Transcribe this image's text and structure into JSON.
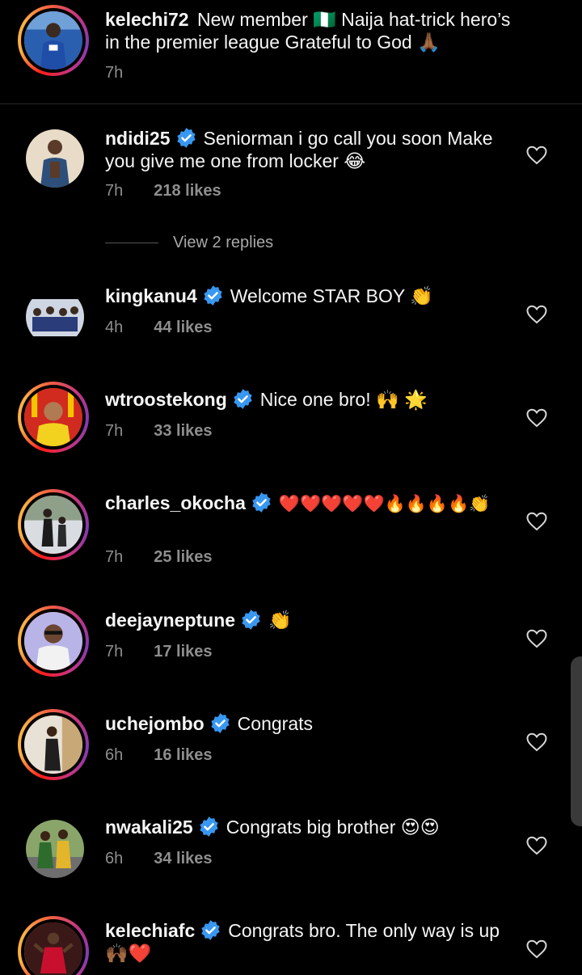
{
  "caption": {
    "username": "kelechi72",
    "text": "New member 🇳🇬 Naija hat-trick hero’s in the premier league Grateful to God 🙏🏾",
    "time": "7h"
  },
  "replies_toggle": {
    "label": "View 2 replies"
  },
  "comments": [
    {
      "username": "ndidi25",
      "text": "Seniorman i go call you soon Make you give me one from locker 😂",
      "time": "7h",
      "likes": "218 likes",
      "verified": true
    },
    {
      "username": "kingkanu4",
      "text": "Welcome STAR BOY 👏",
      "time": "4h",
      "likes": "44 likes",
      "verified": true
    },
    {
      "username": "wtroostekong",
      "text": "Nice one bro! 🙌 🌟",
      "time": "7h",
      "likes": "33 likes",
      "verified": true
    },
    {
      "username": "charles_okocha",
      "text": "❤️❤️❤️❤️❤️🔥🔥🔥🔥👏",
      "time": "7h",
      "likes": "25 likes",
      "verified": true
    },
    {
      "username": "deejayneptune",
      "text": "👏",
      "time": "7h",
      "likes": "17 likes",
      "verified": true
    },
    {
      "username": "uchejombo",
      "text": "Congrats",
      "time": "6h",
      "likes": "16 likes",
      "verified": true
    },
    {
      "username": "nwakali25",
      "text": "Congrats big brother 😍😍",
      "time": "6h",
      "likes": "34 likes",
      "verified": true
    },
    {
      "username": "kelechiafc",
      "text": "Congrats bro. The only way is up 🙌🏾❤️",
      "time": "",
      "likes": "",
      "verified": true
    }
  ],
  "colors": {
    "background": "#000000",
    "verified_blue": "#3897f0",
    "muted_text": "#8e8e8e"
  },
  "icons": {
    "verified": "verified-badge-icon",
    "like": "heart-outline-icon"
  }
}
